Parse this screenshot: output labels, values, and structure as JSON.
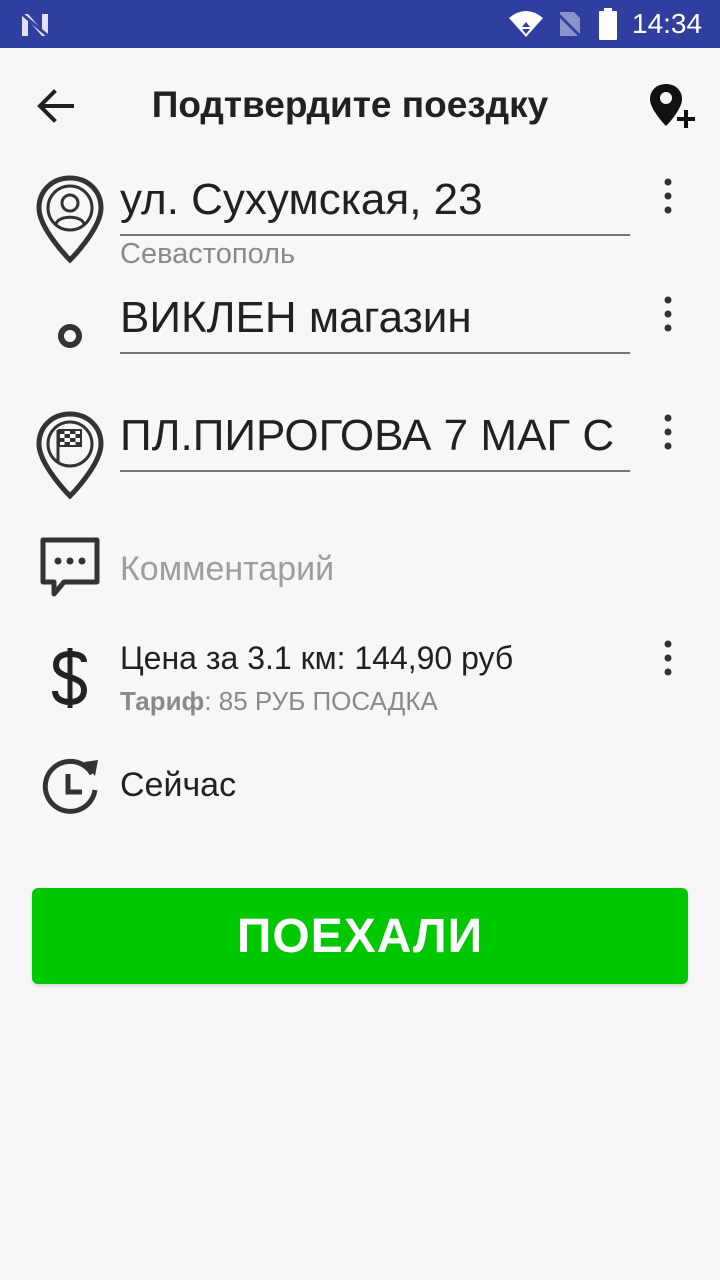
{
  "status_bar": {
    "time": "14:34",
    "icons": [
      "n-logo-icon",
      "wifi-icon",
      "no-sim-icon",
      "battery-icon"
    ]
  },
  "header": {
    "title": "Подтвердите поездку",
    "back_icon": "arrow-left-icon",
    "add_stop_icon": "add-location-icon"
  },
  "route": {
    "origin": {
      "address": "ул. Сухумская, 23",
      "city": "Севастополь",
      "icon": "person-pin-icon"
    },
    "stop": {
      "address": "ВИКЛЕН магазин",
      "icon": "waypoint-dot-icon"
    },
    "destination": {
      "address": "ПЛ.ПИРОГОВА 7 МАГ С",
      "icon": "checkered-flag-pin-icon"
    }
  },
  "comment": {
    "placeholder": "Комментарий",
    "icon": "comment-icon"
  },
  "price": {
    "text": "Цена за 3.1 км: 144,90 руб",
    "tariff_label": "Тариф",
    "tariff_value": ": 85 РУБ ПОСАДКА",
    "icon": "dollar-icon"
  },
  "time": {
    "label": "Сейчас",
    "icon": "clock-refresh-icon"
  },
  "go_button": {
    "label": "ПОЕХАЛИ",
    "color": "#00c800"
  },
  "colors": {
    "status_bar": "#303f9f",
    "background": "#f7f7f7",
    "accent_green": "#00c800"
  }
}
